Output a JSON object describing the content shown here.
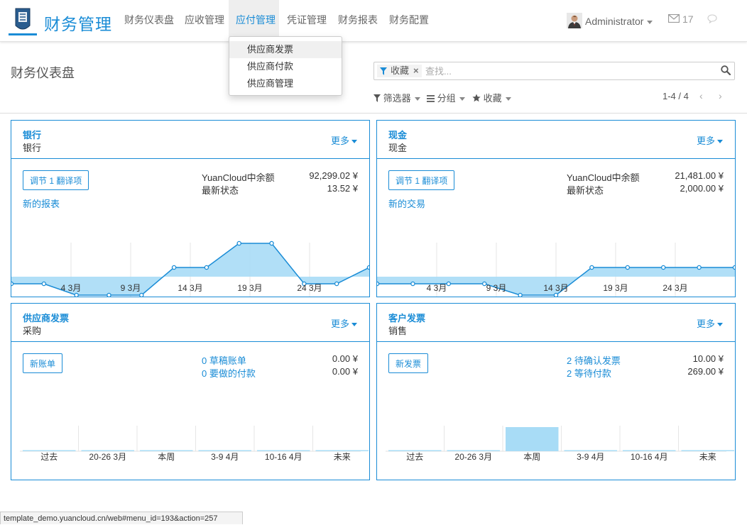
{
  "app": {
    "title": "财务管理"
  },
  "nav": {
    "items": [
      "财务仪表盘",
      "应收管理",
      "应付管理",
      "凭证管理",
      "财务报表",
      "财务配置"
    ],
    "active_index": 2
  },
  "dropdown": {
    "items": [
      "供应商发票",
      "供应商付款",
      "供应商管理"
    ],
    "hover_index": 0
  },
  "user": {
    "name": "Administrator",
    "mail_count": "17"
  },
  "control_panel": {
    "page_title": "财务仪表盘",
    "facet_label": "收藏",
    "facet_remove": "×",
    "search_placeholder": "查找...",
    "filter_label": "筛选器",
    "group_label": "分组",
    "favorite_label": "收藏",
    "pager_value": "1-4 / 4",
    "pager_prev": "‹",
    "pager_next": "›"
  },
  "cards": [
    {
      "title": "银行",
      "subtitle": "银行",
      "more": "更多",
      "button": "调节 1 翻译项",
      "link": "新的报表",
      "stats": [
        {
          "label": "YuanCloud中余额",
          "value": "92,299.02 ¥"
        },
        {
          "label": "最新状态",
          "value": "13.52 ¥"
        }
      ]
    },
    {
      "title": "现金",
      "subtitle": "现金",
      "more": "更多",
      "button": "调节 1 翻译项",
      "link": "新的交易",
      "stats": [
        {
          "label": "YuanCloud中余额",
          "value": "21,481.00 ¥"
        },
        {
          "label": "最新状态",
          "value": "2,000.00 ¥"
        }
      ]
    },
    {
      "title": "供应商发票",
      "subtitle": "采购",
      "more": "更多",
      "button": "新账单",
      "stats": [
        {
          "label": "0 草稿账单",
          "value": "0.00 ¥"
        },
        {
          "label": "0 要做的付款",
          "value": "0.00 ¥"
        }
      ]
    },
    {
      "title": "客户发票",
      "subtitle": "销售",
      "more": "更多",
      "button": "新发票",
      "stats": [
        {
          "label": "2 待确认发票",
          "value": "10.00 ¥"
        },
        {
          "label": "2 等待付款",
          "value": "269.00 ¥"
        }
      ]
    }
  ],
  "chart_data": [
    {
      "type": "line",
      "x_tick_labels": [
        "4 3月",
        "9 3月",
        "14 3月",
        "19 3月",
        "24 3月"
      ],
      "series": [
        {
          "values": [
            0,
            0,
            -1,
            -1,
            -1,
            1,
            1,
            3,
            3,
            0,
            0,
            1
          ]
        }
      ]
    },
    {
      "type": "line",
      "x_tick_labels": [
        "4 3月",
        "9 3月",
        "14 3月",
        "19 3月",
        "24 3月"
      ],
      "series": [
        {
          "values": [
            0,
            0,
            0,
            0,
            -1,
            -1,
            1,
            1,
            1,
            1,
            1
          ]
        }
      ]
    },
    {
      "type": "bar",
      "categories": [
        "过去",
        "20-26 3月",
        "本周",
        "3-9 4月",
        "10-16 4月",
        "未来"
      ],
      "values": [
        0,
        0,
        0,
        0,
        0,
        0
      ]
    },
    {
      "type": "bar",
      "categories": [
        "过去",
        "20-26 3月",
        "本周",
        "3-9 4月",
        "10-16 4月",
        "未来"
      ],
      "values": [
        0,
        0,
        1,
        0,
        0,
        0
      ]
    }
  ],
  "status_bar": {
    "url": "template_demo.yuancloud.cn/web#menu_id=193&action=257"
  },
  "colors": {
    "accent": "#1a8cd6",
    "chart_fill": "#a8dcf6",
    "chart_line": "#1a8cd6"
  }
}
